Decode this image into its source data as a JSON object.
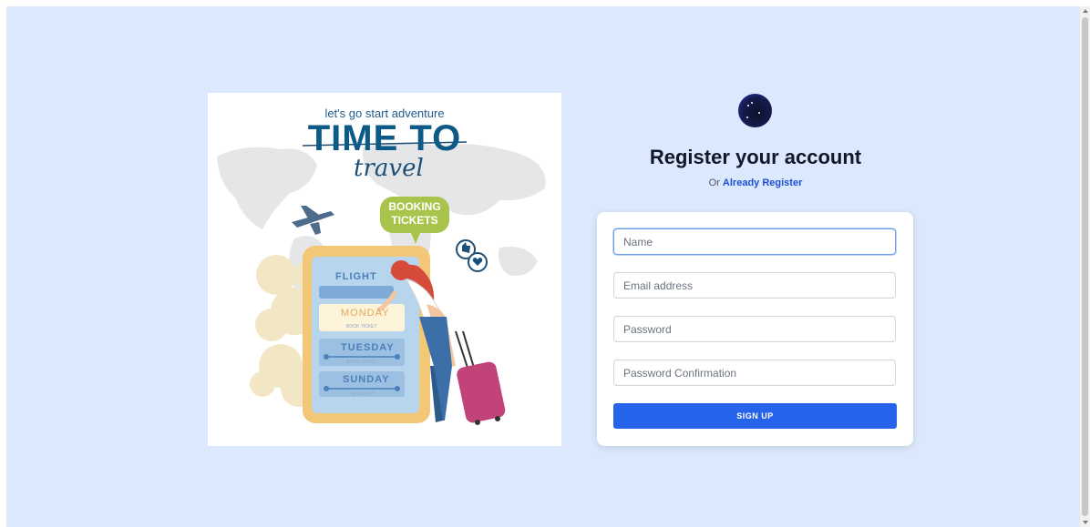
{
  "illustration": {
    "tagline": "let's go start adventure",
    "title": "TIME TO",
    "script": "travel",
    "bubble_line1": "BOOKING",
    "bubble_line2": "TICKETS",
    "phone_flight": "FLIGHT",
    "phone_day1": "MONDAY",
    "phone_day2": "TUESDAY",
    "phone_day3": "SUNDAY",
    "phone_sub1": "BOOK TICKET",
    "phone_sub2": "BOOK TICKET",
    "phone_sub3": "SOLD OUT"
  },
  "form": {
    "heading": "Register your account",
    "subtext_prefix": "Or",
    "login_link": "Already Register",
    "fields": {
      "name": {
        "placeholder": "Name",
        "value": ""
      },
      "email": {
        "placeholder": "Email address",
        "value": ""
      },
      "password": {
        "placeholder": "Password",
        "value": ""
      },
      "password_confirmation": {
        "placeholder": "Password Confirmation",
        "value": ""
      }
    },
    "submit_label": "SIGN UP"
  },
  "colors": {
    "page_background": "#dbe8fd",
    "primary_button": "#2563eb",
    "link": "#1d4ed8",
    "heading": "#111827"
  }
}
